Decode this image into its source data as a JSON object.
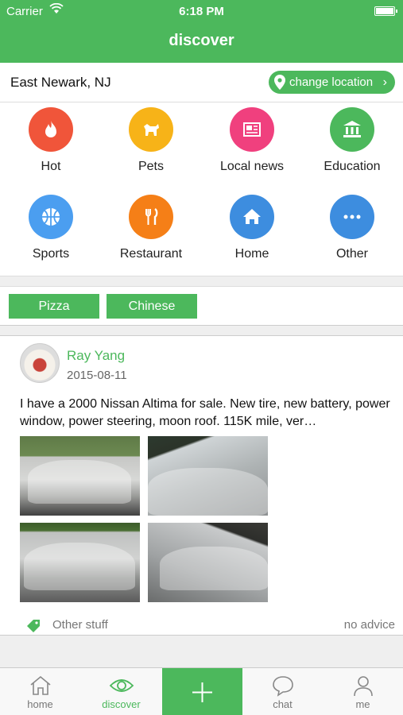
{
  "status": {
    "carrier": "Carrier",
    "time": "6:18 PM"
  },
  "header": {
    "title": "discover"
  },
  "location": {
    "current": "East Newark, NJ",
    "change_label": "change location"
  },
  "categories": [
    {
      "label": "Hot",
      "icon": "flame-icon",
      "color": "#f0553a"
    },
    {
      "label": "Pets",
      "icon": "dog-icon",
      "color": "#f7b318"
    },
    {
      "label": "Local news",
      "icon": "newspaper-icon",
      "color": "#f0407e"
    },
    {
      "label": "Education",
      "icon": "school-icon",
      "color": "#4cb85c"
    },
    {
      "label": "Sports",
      "icon": "basketball-icon",
      "color": "#4b9ef0"
    },
    {
      "label": "Restaurant",
      "icon": "fork-knife-icon",
      "color": "#f57f17"
    },
    {
      "label": "Home",
      "icon": "house-icon",
      "color": "#3d8ddf"
    },
    {
      "label": "Other",
      "icon": "more-icon",
      "color": "#3d8ddf"
    }
  ],
  "tags": [
    "Pizza",
    "Chinese"
  ],
  "post": {
    "author": "Ray Yang",
    "date": "2015-08-11",
    "text": "I have a 2000 Nissan Altima for sale. New tire, new battery, power window, power steering, moon roof. 115K mile, ver…",
    "category": "Other stuff",
    "advice": "no advice"
  },
  "tabbar": {
    "home": "home",
    "discover": "discover",
    "chat": "chat",
    "me": "me"
  },
  "colors": {
    "accent": "#4cb85c"
  }
}
